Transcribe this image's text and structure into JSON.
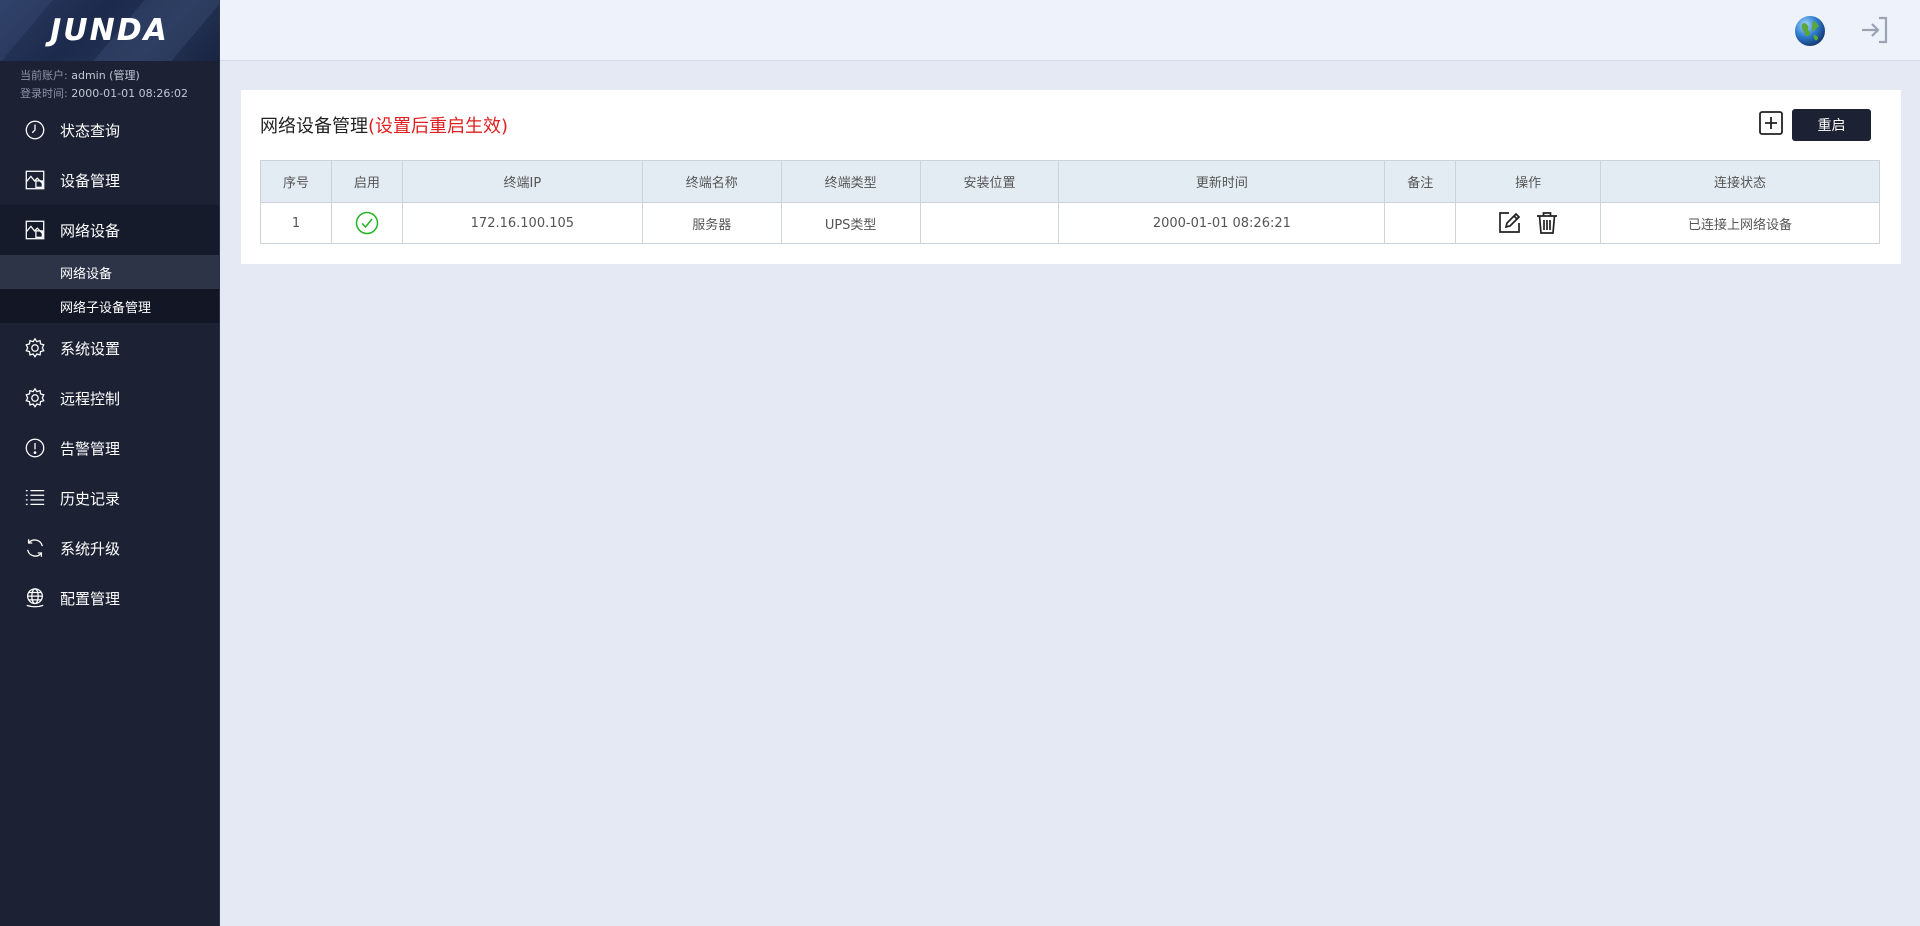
{
  "brand": {
    "logo_text": "JUNDA"
  },
  "account": {
    "current_label": "当前账户:",
    "current_value": "admin (管理)",
    "login_label": "登录时间:",
    "login_value": "2000-01-01 08:26:02"
  },
  "sidebar": {
    "items": [
      {
        "label": "状态查询",
        "icon": "clock-icon"
      },
      {
        "label": "设备管理",
        "icon": "device-icon"
      },
      {
        "label": "网络设备",
        "icon": "network-device-icon",
        "active": true,
        "children": [
          {
            "label": "网络设备",
            "active": true
          },
          {
            "label": "网络子设备管理"
          }
        ]
      },
      {
        "label": "系统设置",
        "icon": "gear-icon"
      },
      {
        "label": "远程控制",
        "icon": "gear-icon"
      },
      {
        "label": "告警管理",
        "icon": "alert-icon"
      },
      {
        "label": "历史记录",
        "icon": "list-icon"
      },
      {
        "label": "系统升级",
        "icon": "refresh-icon"
      },
      {
        "label": "配置管理",
        "icon": "globe-hand-icon"
      }
    ]
  },
  "topbar": {
    "icons": [
      "globe-icon",
      "exit-icon"
    ]
  },
  "panel": {
    "title": "网络设备管理",
    "title_note": "(设置后重启生效)",
    "restart_label": "重启",
    "add_icon": "plus-square-icon"
  },
  "table": {
    "headers": [
      "序号",
      "启用",
      "终端IP",
      "终端名称",
      "终端类型",
      "安装位置",
      "更新时间",
      "备注",
      "操作",
      "连接状态"
    ],
    "rows": [
      {
        "index": "1",
        "enabled": true,
        "ip": "172.16.100.105",
        "name": "服务器",
        "type": "UPS类型",
        "location": "",
        "updated": "2000-01-01 08:26:21",
        "remark": "",
        "status": "已连接上网络设备"
      }
    ]
  },
  "colors": {
    "sidebar_bg": "#1c2133",
    "page_bg": "#e4e9f3",
    "accent_red": "#e02020",
    "status_green": "#1f8a1f",
    "enabled_green": "#22b422"
  }
}
